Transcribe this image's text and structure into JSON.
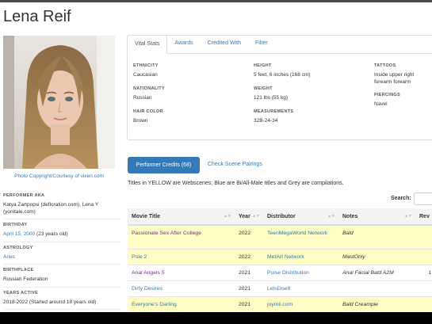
{
  "performer": {
    "name": "Lena Reif",
    "photo_credit": "Photo Copyright/Courtesy of vixen.com"
  },
  "facts": [
    {
      "label": "PERFORMER AKA",
      "value": "Katya Zartpopsi (defloration.com), Lena Y (yonitale.com)",
      "link": false
    },
    {
      "label": "BIRTHDAY",
      "value": "April 15, 2000",
      "extra": "(23 years old)",
      "link": true
    },
    {
      "label": "ASTROLOGY",
      "value": "Aries",
      "link": true
    },
    {
      "label": "BIRTHPLACE",
      "value": "Russian Federation",
      "link": false
    },
    {
      "label": "YEARS ACTIVE",
      "value": "2018-2022 (Started around 18 years old)",
      "link": false
    }
  ],
  "tabs": [
    "Vital Stats",
    "Awards",
    "Credited With",
    "Filter"
  ],
  "vital_stats": {
    "ethnicity": {
      "label": "ETHNICITY",
      "value": "Caucasian"
    },
    "nationality": {
      "label": "NATIONALITY",
      "value": "Russian"
    },
    "hair": {
      "label": "HAIR COLOR",
      "value": "Brown"
    },
    "height": {
      "label": "HEIGHT",
      "value": "5 feet, 6 inches (168 cm)"
    },
    "weight": {
      "label": "WEIGHT",
      "value": "121 lbs (55 kg)"
    },
    "measurements": {
      "label": "MEASUREMENTS",
      "value": "32B-24-34"
    },
    "tattoos": {
      "label": "TATTOOS",
      "value": "Inside upper right forearm forearm"
    },
    "piercings": {
      "label": "PIERCINGS",
      "value": "Navel"
    }
  },
  "credits": {
    "button": "Performer Credits (68)",
    "scene_link": "Check Scene Pairings",
    "legend": "Titles in YELLOW are Webscenes; Blue are Bi/All-Male titles and Grey are compilations.",
    "search_label": "Search:",
    "columns": [
      "Movie Title",
      "Year",
      "Distributor",
      "Notes",
      "Rev"
    ],
    "rows": [
      {
        "title": "Passionate Sex After College",
        "year": "2022",
        "distributor": "TeenMegaWorld Network",
        "notes": "Bald",
        "rev": "",
        "kind": "yellow",
        "title_color": "purple"
      },
      {
        "title": "Pole 2",
        "year": "2022",
        "distributor": "MetArt Network",
        "notes": "MastOnly",
        "rev": "",
        "kind": "yellow",
        "title_color": "link"
      },
      {
        "title": "Anal Angels 5",
        "year": "2021",
        "distributor": "Pulse Distribution",
        "notes": "Anal Facial Bald A2M",
        "rev": "1",
        "kind": "white",
        "title_color": "purple"
      },
      {
        "title": "Dirty Desires",
        "year": "2021",
        "distributor": "LetsDoeIt",
        "notes": "",
        "rev": "",
        "kind": "white",
        "title_color": "link"
      },
      {
        "title": "Everyone's Darling",
        "year": "2021",
        "distributor": "joymii.com",
        "notes": "Bald Creampie",
        "rev": "",
        "kind": "yellow",
        "title_color": "link"
      }
    ]
  }
}
